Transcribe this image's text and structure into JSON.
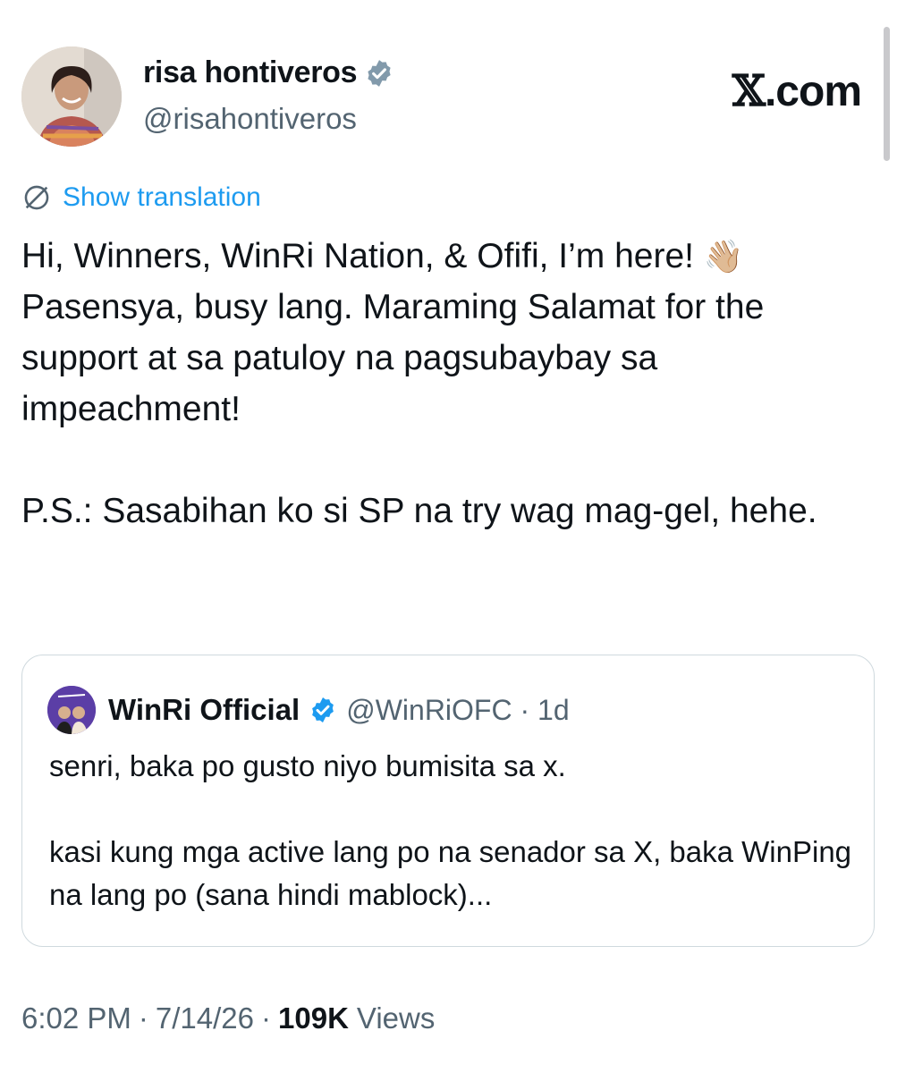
{
  "author": {
    "display_name": "risa hontiveros",
    "handle": "@risahontiveros",
    "avatar_icon": "profile-photo",
    "verified_icon": "verified-badge-icon"
  },
  "brand": {
    "x_glyph": "𝕏",
    "label": ".com"
  },
  "translation": {
    "label": "Show translation",
    "icon": "globe-slash-icon"
  },
  "tweet": {
    "text_part1": "Hi, Winners, WinRi Nation, & Ofifi, I’m here! ",
    "emoji": "👋🏼",
    "text_part2": "\nPasensya, busy lang. Maraming Salamat for the support at sa patuloy na pagsubaybay sa impeachment!\n\nP.S.: Sasabihan ko si SP na try wag mag-gel, hehe."
  },
  "quoted_tweet": {
    "display_name": "WinRi Official",
    "handle_time": "@WinRiOFC · 1d",
    "text": "senri, baka po gusto niyo bumisita sa x.\n\nkasi kung mga active lang po na senador sa X, baka WinPing na lang po (sana hindi mablock)..."
  },
  "meta": {
    "time": "6:02 PM",
    "date": "7/14/26",
    "views_count": "109K",
    "views_label": "Views",
    "separator": "·"
  },
  "colors": {
    "accent": "#1d9bf0",
    "muted": "#536471",
    "text": "#0f1419",
    "border": "#cfd9de"
  }
}
